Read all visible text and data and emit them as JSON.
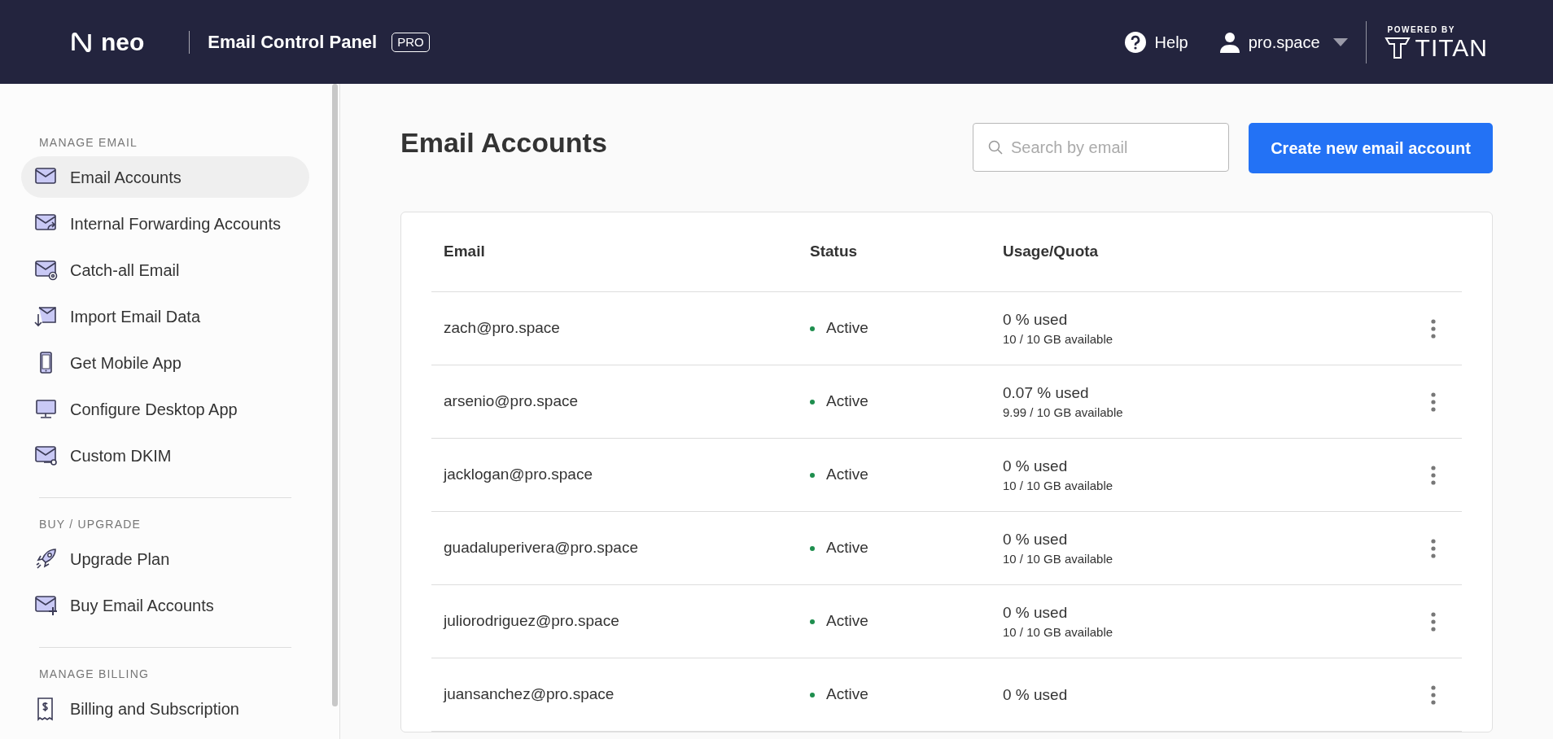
{
  "header": {
    "logo": "neo",
    "title": "Email Control Panel",
    "badge": "PRO",
    "help": "Help",
    "user": "pro.space",
    "powered_by": "POWERED BY",
    "brand": "TITAN"
  },
  "sidebar": {
    "sections": [
      {
        "heading": "MANAGE EMAIL",
        "items": [
          {
            "label": "Email Accounts",
            "selected": true
          },
          {
            "label": "Internal Forwarding Accounts",
            "selected": false
          },
          {
            "label": "Catch-all Email",
            "selected": false
          },
          {
            "label": "Import Email Data",
            "selected": false
          },
          {
            "label": "Get Mobile App",
            "selected": false
          },
          {
            "label": "Configure Desktop App",
            "selected": false
          },
          {
            "label": "Custom DKIM",
            "selected": false
          }
        ]
      },
      {
        "heading": "BUY / UPGRADE",
        "items": [
          {
            "label": "Upgrade Plan",
            "selected": false
          },
          {
            "label": "Buy Email Accounts",
            "selected": false
          }
        ]
      },
      {
        "heading": "MANAGE BILLING",
        "items": [
          {
            "label": "Billing and Subscription",
            "selected": false
          }
        ]
      }
    ]
  },
  "main": {
    "title": "Email Accounts",
    "search": {
      "placeholder": "Search by email"
    },
    "create_button": "Create new email account",
    "table": {
      "columns": [
        "Email",
        "Status",
        "Usage/Quota"
      ],
      "rows": [
        {
          "email": "zach@pro.space",
          "status": "Active",
          "color": "#1e8e4e",
          "used": "0 % used",
          "available": "10 / 10 GB available"
        },
        {
          "email": "arsenio@pro.space",
          "status": "Active",
          "color": "#1e8e4e",
          "used": "0.07 % used",
          "available": "9.99 / 10 GB available"
        },
        {
          "email": "jacklogan@pro.space",
          "status": "Active",
          "color": "#1e8e4e",
          "used": "0 % used",
          "available": "10 / 10 GB available"
        },
        {
          "email": "guadaluperivera@pro.space",
          "status": "Active",
          "color": "#1e8e4e",
          "used": "0 % used",
          "available": "10 / 10 GB available"
        },
        {
          "email": "juliorodriguez@pro.space",
          "status": "Active",
          "color": "#1e8e4e",
          "used": "0 % used",
          "available": "10 / 10 GB available"
        },
        {
          "email": "juansanchez@pro.space",
          "status": "Active",
          "color": "#1e8e4e",
          "used": "0 % used"
        }
      ]
    }
  }
}
